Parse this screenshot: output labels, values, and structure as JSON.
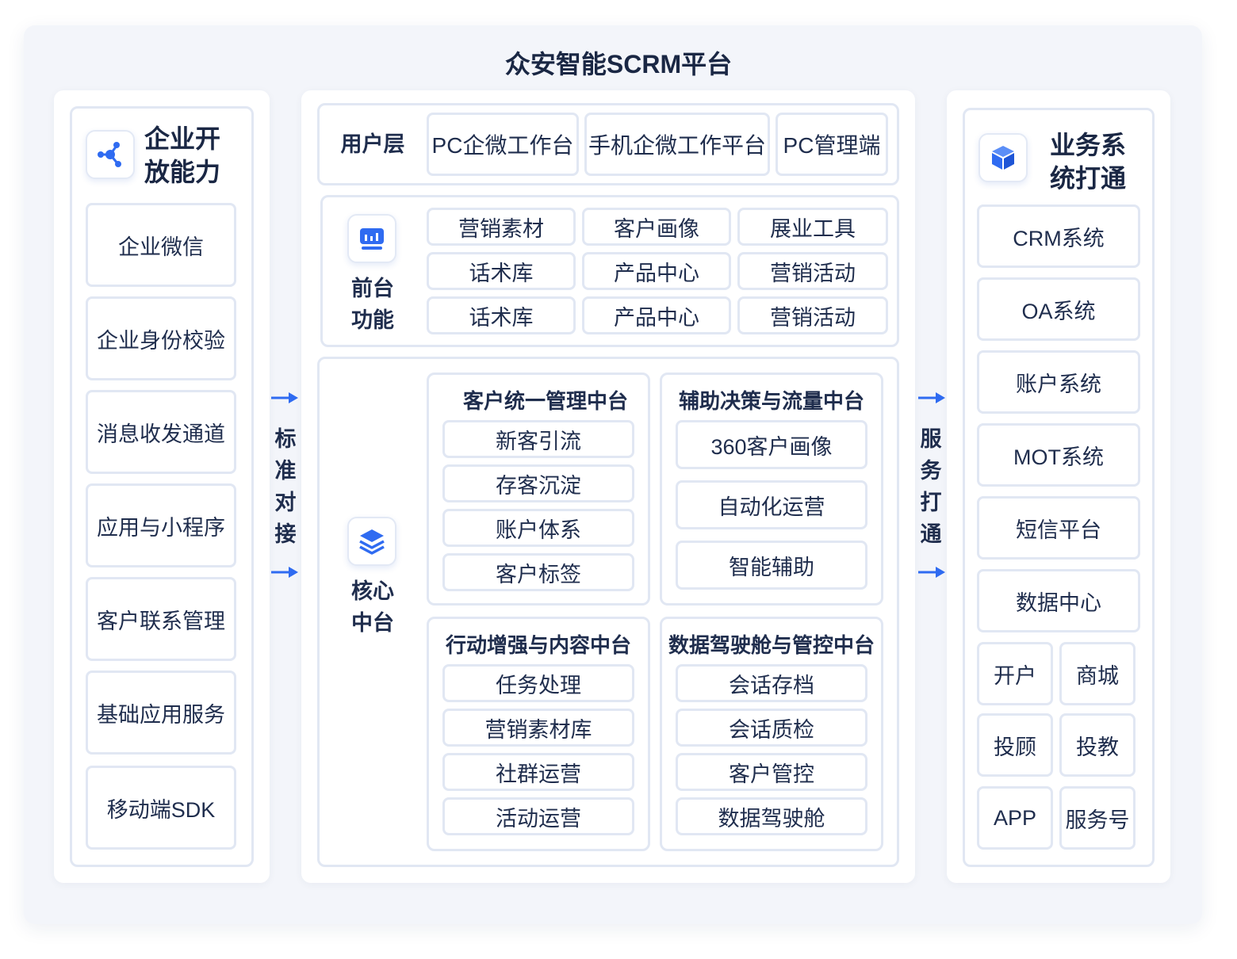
{
  "title": "众安智能SCRM平台",
  "left": {
    "heading_line1": "企业开",
    "heading_line2": "放能力",
    "icon": "network-nodes-icon",
    "items": [
      "企业微信",
      "企业身份校验",
      "消息收发通道",
      "应用与小程序",
      "客户联系管理",
      "基础应用服务",
      "移动端SDK"
    ]
  },
  "connector_left": {
    "chars": [
      "标",
      "准",
      "对",
      "接"
    ]
  },
  "connector_right": {
    "chars": [
      "服",
      "务",
      "打",
      "通"
    ]
  },
  "user_layer": {
    "label": "用户层",
    "items": [
      "PC企微工作台",
      "手机企微工作平台",
      "PC管理端"
    ]
  },
  "front": {
    "label_line1": "前台",
    "label_line2": "功能",
    "icon": "dashboard-icon",
    "grid": [
      [
        "营销素材",
        "客户画像",
        "展业工具"
      ],
      [
        "话术库",
        "产品中心",
        "营销活动"
      ],
      [
        "话术库",
        "产品中心",
        "营销活动"
      ]
    ]
  },
  "core": {
    "label_line1": "核心",
    "label_line2": "中台",
    "icon": "layers-icon",
    "customer": {
      "title": "客户统一管理中台",
      "items": [
        "新客引流",
        "存客沉淀",
        "账户体系",
        "客户标签"
      ]
    },
    "decision": {
      "title": "辅助决策与流量中台",
      "items": [
        "360客户画像",
        "自动化运营",
        "智能辅助"
      ]
    },
    "action": {
      "title": "行动增强与内容中台",
      "items": [
        "任务处理",
        "营销素材库",
        "社群运营",
        "活动运营"
      ]
    },
    "data": {
      "title": "数据驾驶舱与管控中台",
      "items": [
        "会话存档",
        "会话质检",
        "客户管控",
        "数据驾驶舱"
      ]
    }
  },
  "right": {
    "heading_line1": "业务系",
    "heading_line2": "统打通",
    "icon": "cube-icon",
    "items": [
      "CRM系统",
      "OA系统",
      "账户系统",
      "MOT系统",
      "短信平台",
      "数据中心"
    ],
    "small": [
      [
        "开户",
        "商城"
      ],
      [
        "投顾",
        "投教"
      ],
      [
        "APP",
        "服务号"
      ]
    ]
  },
  "colors": {
    "accent": "#2f6bf1",
    "border": "#e1e7f3",
    "background": "#f3f5fa"
  }
}
